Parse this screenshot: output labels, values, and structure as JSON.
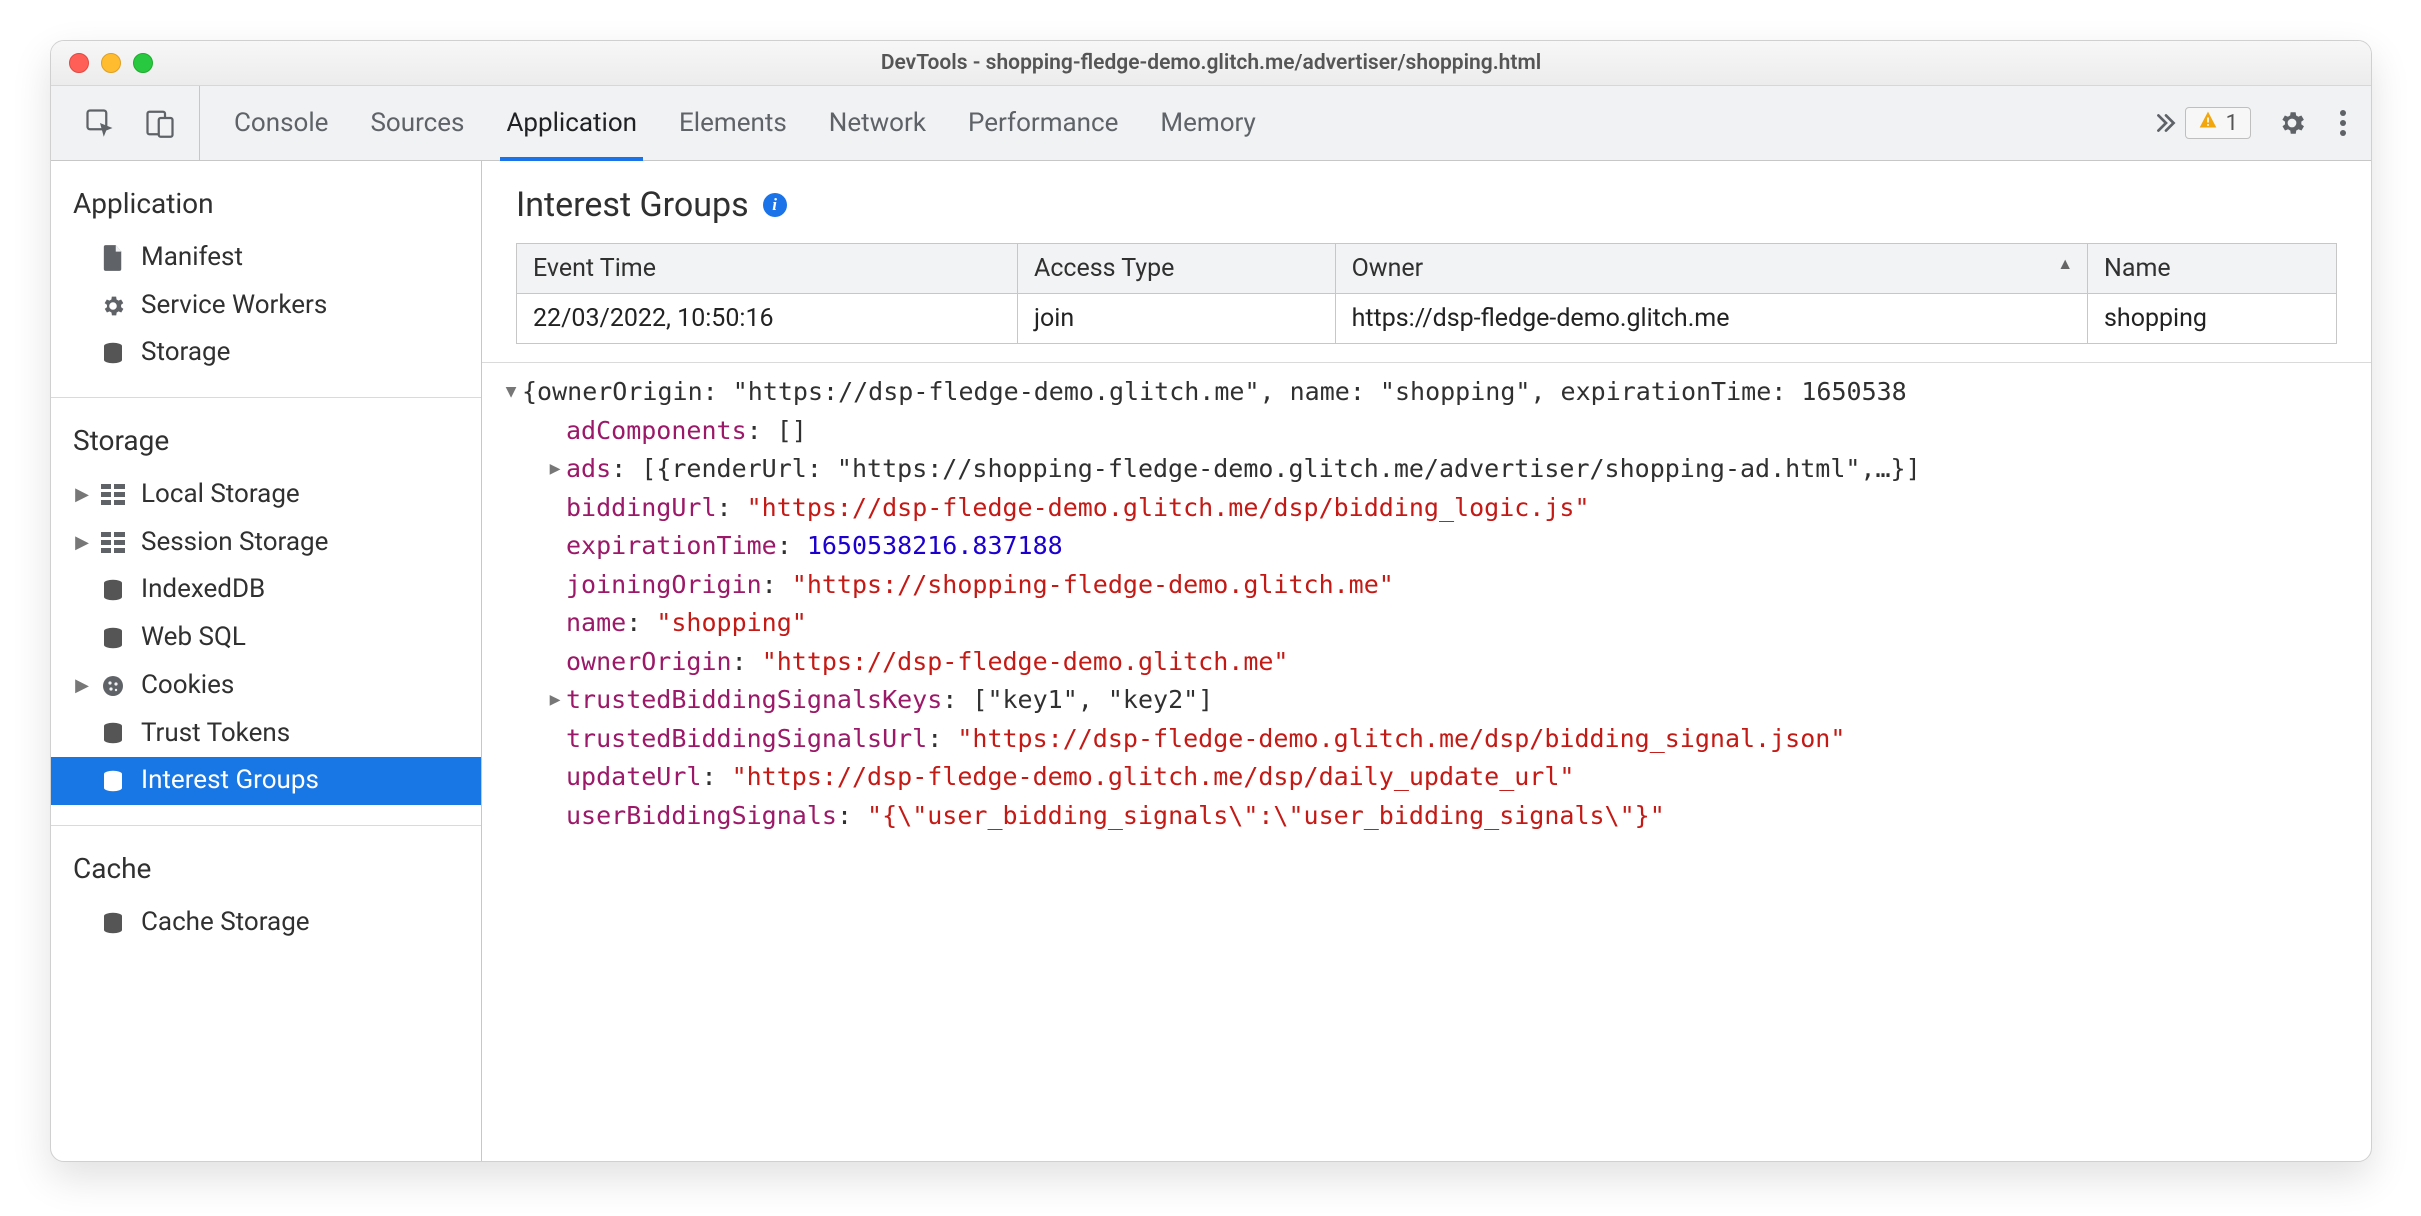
{
  "window_title": "DevTools - shopping-fledge-demo.glitch.me/advertiser/shopping.html",
  "tabs": [
    "Console",
    "Sources",
    "Application",
    "Elements",
    "Network",
    "Performance",
    "Memory"
  ],
  "active_tab": "Application",
  "warning_count": "1",
  "sidebar": {
    "sections": [
      {
        "title": "Application",
        "items": [
          {
            "label": "Manifest",
            "icon": "file",
            "expandable": false
          },
          {
            "label": "Service Workers",
            "icon": "gear",
            "expandable": false
          },
          {
            "label": "Storage",
            "icon": "db",
            "expandable": false
          }
        ]
      },
      {
        "title": "Storage",
        "items": [
          {
            "label": "Local Storage",
            "icon": "grid",
            "expandable": true
          },
          {
            "label": "Session Storage",
            "icon": "grid",
            "expandable": true
          },
          {
            "label": "IndexedDB",
            "icon": "db",
            "expandable": false
          },
          {
            "label": "Web SQL",
            "icon": "db",
            "expandable": false
          },
          {
            "label": "Cookies",
            "icon": "cookie",
            "expandable": true
          },
          {
            "label": "Trust Tokens",
            "icon": "db",
            "expandable": false
          },
          {
            "label": "Interest Groups",
            "icon": "db",
            "expandable": false,
            "selected": true
          }
        ]
      },
      {
        "title": "Cache",
        "items": [
          {
            "label": "Cache Storage",
            "icon": "db",
            "expandable": false
          }
        ]
      }
    ]
  },
  "main": {
    "title": "Interest Groups",
    "table": {
      "headers": [
        "Event Time",
        "Access Type",
        "Owner",
        "Name"
      ],
      "sorted_col": 2,
      "rows": [
        [
          "22/03/2022, 10:50:16",
          "join",
          "https://dsp-fledge-demo.glitch.me",
          "shopping"
        ]
      ]
    },
    "tree": {
      "type": "object",
      "label": "{ownerOrigin: \"https://dsp-fledge-demo.glitch.me\", name: \"shopping\", expirationTime: 1650538",
      "label_cont": "",
      "expanded": true,
      "children": [
        {
          "kind": "kv",
          "key": "adComponents",
          "value": "[]",
          "vtype": "plain"
        },
        {
          "kind": "expandable",
          "key": "ads",
          "value": "[{renderUrl: \"https://shopping-fledge-demo.glitch.me/advertiser/shopping-ad.html\",…}]",
          "vtype": "plain"
        },
        {
          "kind": "kv",
          "key": "biddingUrl",
          "value": "\"https://dsp-fledge-demo.glitch.me/dsp/bidding_logic.js\"",
          "vtype": "string"
        },
        {
          "kind": "kv",
          "key": "expirationTime",
          "value": "1650538216.837188",
          "vtype": "number"
        },
        {
          "kind": "kv",
          "key": "joiningOrigin",
          "value": "\"https://shopping-fledge-demo.glitch.me\"",
          "vtype": "string"
        },
        {
          "kind": "kv",
          "key": "name",
          "value": "\"shopping\"",
          "vtype": "string"
        },
        {
          "kind": "kv",
          "key": "ownerOrigin",
          "value": "\"https://dsp-fledge-demo.glitch.me\"",
          "vtype": "string"
        },
        {
          "kind": "expandable",
          "key": "trustedBiddingSignalsKeys",
          "value": "[\"key1\", \"key2\"]",
          "vtype": "plain"
        },
        {
          "kind": "kv",
          "key": "trustedBiddingSignalsUrl",
          "value": "\"https://dsp-fledge-demo.glitch.me/dsp/bidding_signal.json\"",
          "vtype": "string"
        },
        {
          "kind": "kv",
          "key": "updateUrl",
          "value": "\"https://dsp-fledge-demo.glitch.me/dsp/daily_update_url\"",
          "vtype": "string"
        },
        {
          "kind": "kv",
          "key": "userBiddingSignals",
          "value": "\"{\\\"user_bidding_signals\\\":\\\"user_bidding_signals\\\"}\"",
          "vtype": "string"
        }
      ]
    }
  }
}
